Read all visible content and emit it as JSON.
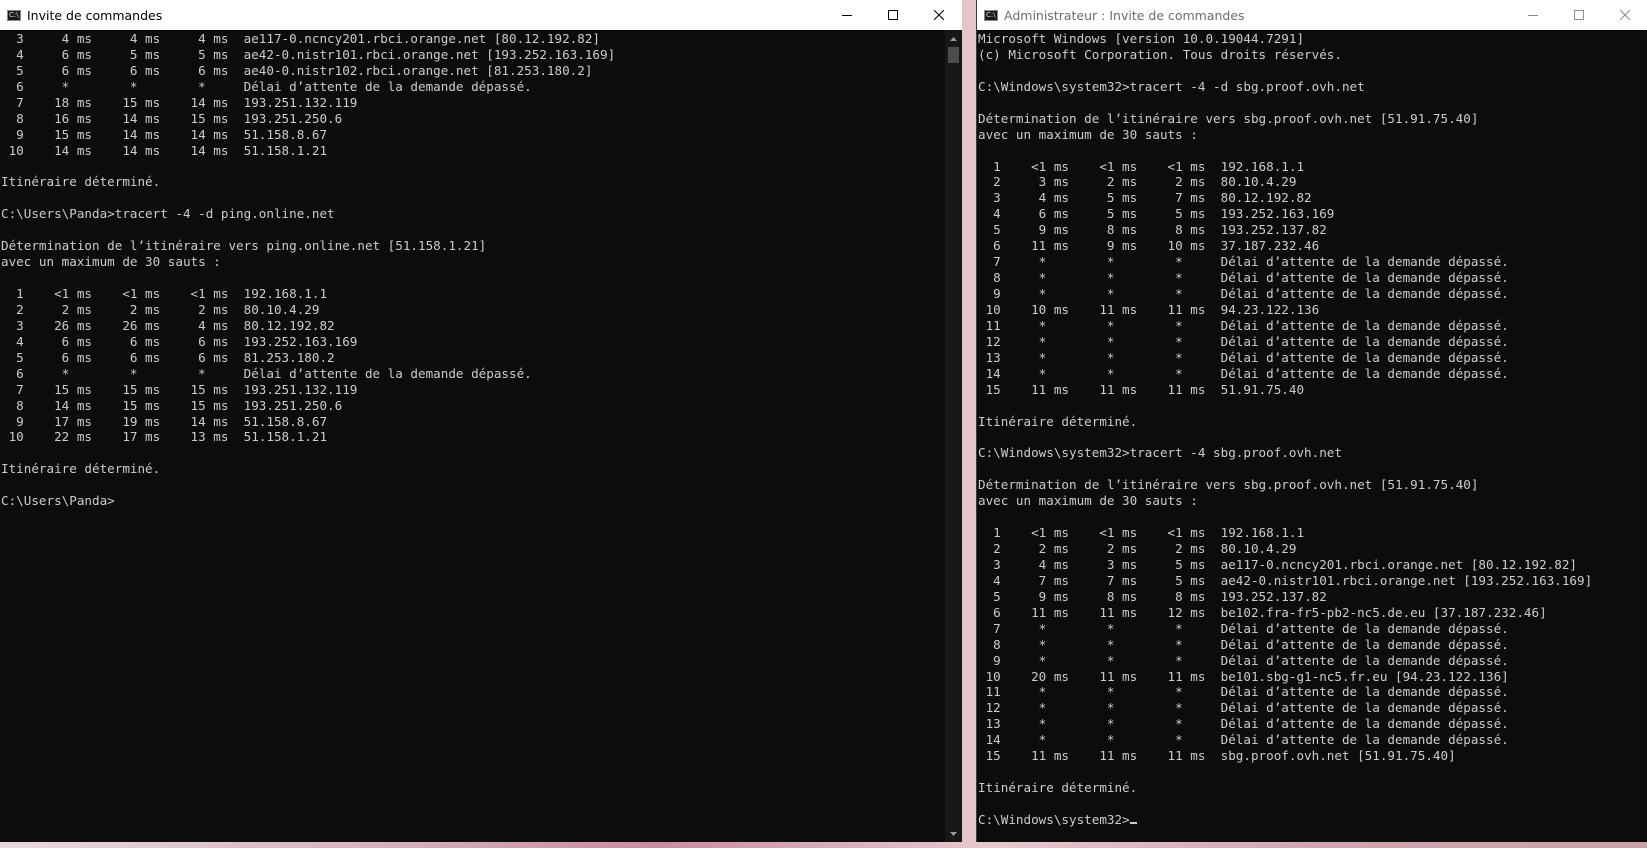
{
  "left_window": {
    "title": "Invite de commandes",
    "lines": [
      "  3     4 ms     4 ms     4 ms  ae117-0.ncncy201.rbci.orange.net [80.12.192.82]",
      "  4     6 ms     5 ms     5 ms  ae42-0.nistr101.rbci.orange.net [193.252.163.169]",
      "  5     6 ms     6 ms     6 ms  ae40-0.nistr102.rbci.orange.net [81.253.180.2]",
      "  6     *        *        *     Délai d’attente de la demande dépassé.",
      "  7    18 ms    15 ms    14 ms  193.251.132.119",
      "  8    16 ms    14 ms    15 ms  193.251.250.6",
      "  9    15 ms    14 ms    14 ms  51.158.8.67",
      " 10    14 ms    14 ms    14 ms  51.158.1.21",
      "",
      "Itinéraire déterminé.",
      "",
      "C:\\Users\\Panda>tracert -4 -d ping.online.net",
      "",
      "Détermination de l’itinéraire vers ping.online.net [51.158.1.21]",
      "avec un maximum de 30 sauts :",
      "",
      "  1    <1 ms    <1 ms    <1 ms  192.168.1.1",
      "  2     2 ms     2 ms     2 ms  80.10.4.29",
      "  3    26 ms    26 ms     4 ms  80.12.192.82",
      "  4     6 ms     6 ms     6 ms  193.252.163.169",
      "  5     6 ms     6 ms     6 ms  81.253.180.2",
      "  6     *        *        *     Délai d’attente de la demande dépassé.",
      "  7    15 ms    15 ms    15 ms  193.251.132.119",
      "  8    14 ms    15 ms    15 ms  193.251.250.6",
      "  9    17 ms    19 ms    14 ms  51.158.8.67",
      " 10    22 ms    17 ms    13 ms  51.158.1.21",
      "",
      "Itinéraire déterminé.",
      "",
      "C:\\Users\\Panda>"
    ]
  },
  "right_window": {
    "title": "Administrateur : Invite de commandes",
    "lines": [
      "Microsoft Windows [version 10.0.19044.7291]",
      "(c) Microsoft Corporation. Tous droits réservés.",
      "",
      "C:\\Windows\\system32>tracert -4 -d sbg.proof.ovh.net",
      "",
      "Détermination de l’itinéraire vers sbg.proof.ovh.net [51.91.75.40]",
      "avec un maximum de 30 sauts :",
      "",
      "  1    <1 ms    <1 ms    <1 ms  192.168.1.1",
      "  2     3 ms     2 ms     2 ms  80.10.4.29",
      "  3     4 ms     5 ms     7 ms  80.12.192.82",
      "  4     6 ms     5 ms     5 ms  193.252.163.169",
      "  5     9 ms     8 ms     8 ms  193.252.137.82",
      "  6    11 ms     9 ms    10 ms  37.187.232.46",
      "  7     *        *        *     Délai d’attente de la demande dépassé.",
      "  8     *        *        *     Délai d’attente de la demande dépassé.",
      "  9     *        *        *     Délai d’attente de la demande dépassé.",
      " 10    10 ms    11 ms    11 ms  94.23.122.136",
      " 11     *        *        *     Délai d’attente de la demande dépassé.",
      " 12     *        *        *     Délai d’attente de la demande dépassé.",
      " 13     *        *        *     Délai d’attente de la demande dépassé.",
      " 14     *        *        *     Délai d’attente de la demande dépassé.",
      " 15    11 ms    11 ms    11 ms  51.91.75.40",
      "",
      "Itinéraire déterminé.",
      "",
      "C:\\Windows\\system32>tracert -4 sbg.proof.ovh.net",
      "",
      "Détermination de l’itinéraire vers sbg.proof.ovh.net [51.91.75.40]",
      "avec un maximum de 30 sauts :",
      "",
      "  1    <1 ms    <1 ms    <1 ms  192.168.1.1",
      "  2     2 ms     2 ms     2 ms  80.10.4.29",
      "  3     4 ms     3 ms     5 ms  ae117-0.ncncy201.rbci.orange.net [80.12.192.82]",
      "  4     7 ms     7 ms     5 ms  ae42-0.nistr101.rbci.orange.net [193.252.163.169]",
      "  5     9 ms     8 ms     8 ms  193.252.137.82",
      "  6    11 ms    11 ms    12 ms  be102.fra-fr5-pb2-nc5.de.eu [37.187.232.46]",
      "  7     *        *        *     Délai d’attente de la demande dépassé.",
      "  8     *        *        *     Délai d’attente de la demande dépassé.",
      "  9     *        *        *     Délai d’attente de la demande dépassé.",
      " 10    20 ms    11 ms    11 ms  be101.sbg-g1-nc5.fr.eu [94.23.122.136]",
      " 11     *        *        *     Délai d’attente de la demande dépassé.",
      " 12     *        *        *     Délai d’attente de la demande dépassé.",
      " 13     *        *        *     Délai d’attente de la demande dépassé.",
      " 14     *        *        *     Délai d’attente de la demande dépassé.",
      " 15    11 ms    11 ms    11 ms  sbg.proof.ovh.net [51.91.75.40]",
      "",
      "Itinéraire déterminé.",
      ""
    ],
    "prompt": "C:\\Windows\\system32>"
  }
}
